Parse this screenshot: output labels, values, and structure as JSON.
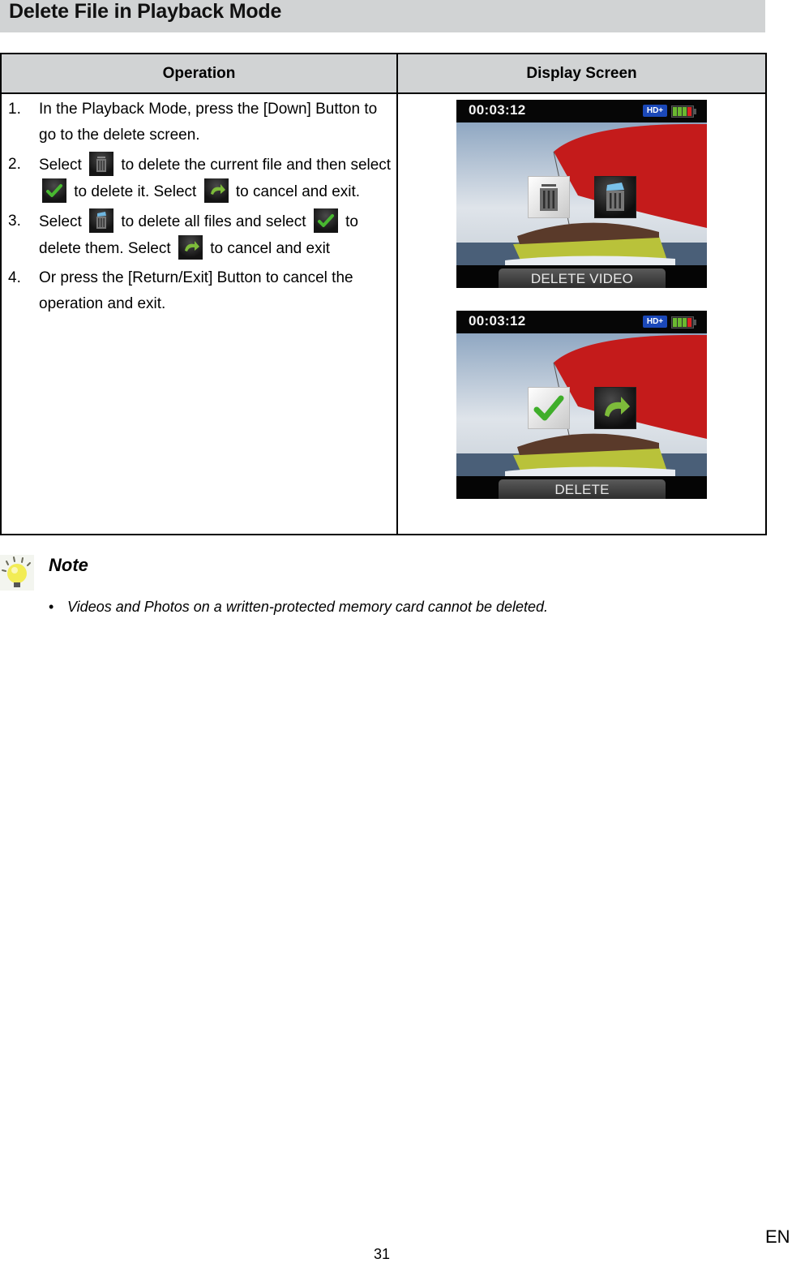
{
  "page": {
    "title": "Delete File in Playback Mode",
    "page_number": "31",
    "language": "EN"
  },
  "table": {
    "headers": {
      "operation": "Operation",
      "display": "Display Screen"
    },
    "steps": [
      {
        "num": "1.",
        "parts": [
          "In the Playback Mode, press the [Down] Button to go to the delete screen."
        ]
      },
      {
        "num": "2.",
        "parts": [
          "Select",
          "to delete the current file and then select",
          "to delete it. Select",
          "to cancel and exit."
        ],
        "icons": [
          "trash-icon",
          "checkmark-icon",
          "undo-icon"
        ]
      },
      {
        "num": "3.",
        "parts": [
          "Select",
          "to delete all files and select",
          "to delete them. Select",
          "to cancel and exit"
        ],
        "icons": [
          "trash-all-icon",
          "checkmark-icon",
          "undo-icon"
        ]
      },
      {
        "num": "4.",
        "parts": [
          "Or press the [Return/Exit] Button to cancel the operation and exit."
        ]
      }
    ],
    "screens": [
      {
        "time": "00:03:12",
        "badge": "HD+",
        "label": "DELETE VIDEO",
        "buttons": [
          "delete-single-icon",
          "delete-all-icon"
        ],
        "selected": "delete-single-icon"
      },
      {
        "time": "00:03:12",
        "badge": "HD+",
        "label": "DELETE",
        "buttons": [
          "confirm-icon",
          "cancel-undo-icon"
        ],
        "selected": "confirm-icon"
      }
    ],
    "colors": {
      "header_bg": "#d1d3d4",
      "sail_red": "#c41b1b",
      "hull_yellow": "#b9c23a",
      "check_green": "#3fae2a",
      "hd_blue": "#1b48b8"
    }
  },
  "note": {
    "title": "Note",
    "items": [
      "Videos and Photos on a written-protected memory card cannot be deleted."
    ],
    "bullet": "•"
  }
}
